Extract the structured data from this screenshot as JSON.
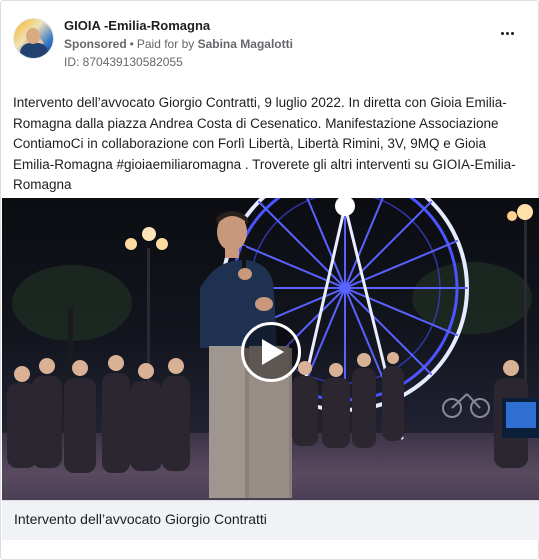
{
  "post": {
    "page_name": "GIOIA -Emilia-Romagna",
    "sponsored_label": "Sponsored",
    "separator": "•",
    "paid_for_prefix": "Paid for by",
    "paid_for_name": "Sabina Magalotti",
    "ad_id": "ID: 870439130582055",
    "more_options_icon": "more-horizontal-icon",
    "body_text": "Intervento dell’avvocato Giorgio Contratti, 9 luglio 2022. In diretta con Gioia Emilia-Romagna dalla piazza Andrea Costa di Cesenatico. Manifestazione Associazione ContiamoCi in collaborazione con Forlì Libertà, Libertà Rimini, 3V, 9MQ e Gioia Emilia-Romagna #gioiaemiliaromagna . Troverete gli altri interventi su GIOIA-Emilia-Romagna"
  },
  "media": {
    "type": "video",
    "play_icon": "play-icon",
    "caption": "Intervento dell’avvocato Giorgio Contratti"
  },
  "colors": {
    "text_primary": "#1c1e21",
    "text_secondary": "#65676b",
    "border": "#dadde1",
    "caption_bg": "#f0f2f5"
  }
}
